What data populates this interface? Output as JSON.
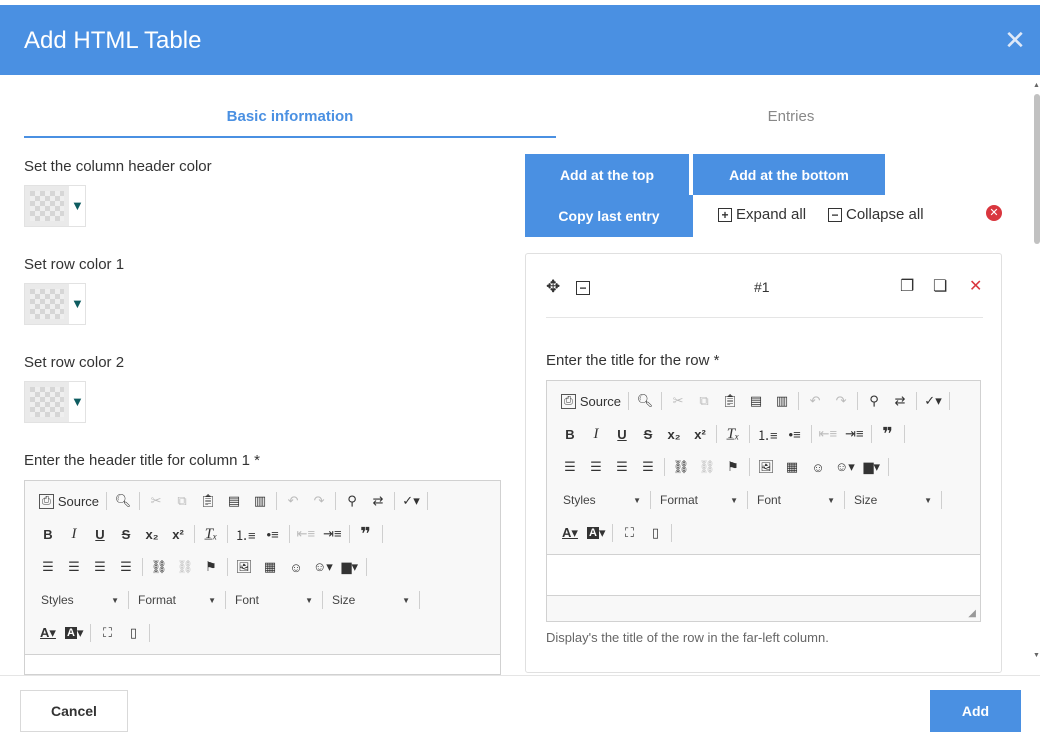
{
  "dialog": {
    "title": "Add HTML Table"
  },
  "tabs": [
    {
      "label": "Basic information",
      "active": true
    },
    {
      "label": "Entries",
      "active": false
    }
  ],
  "left": {
    "header_color_label": "Set the column header color",
    "row_color1_label": "Set row color 1",
    "row_color2_label": "Set row color 2",
    "header_title_label": "Enter the header title for column 1 *"
  },
  "toolbar": {
    "source": "Source",
    "styles": "Styles",
    "format": "Format",
    "font": "Font",
    "size": "Size"
  },
  "entries": {
    "add_top": "Add at the top",
    "add_bottom": "Add at the bottom",
    "copy_last": "Copy last entry",
    "expand_all": "Expand all",
    "collapse_all": "Collapse all",
    "entry_number": "#1",
    "row_title_label": "Enter the title for the row *",
    "row_title_help": "Display's the title of the row in the far-left column."
  },
  "footer": {
    "cancel": "Cancel",
    "add": "Add"
  },
  "colors": {
    "accent": "#4a90e2",
    "danger": "#d9363e"
  }
}
